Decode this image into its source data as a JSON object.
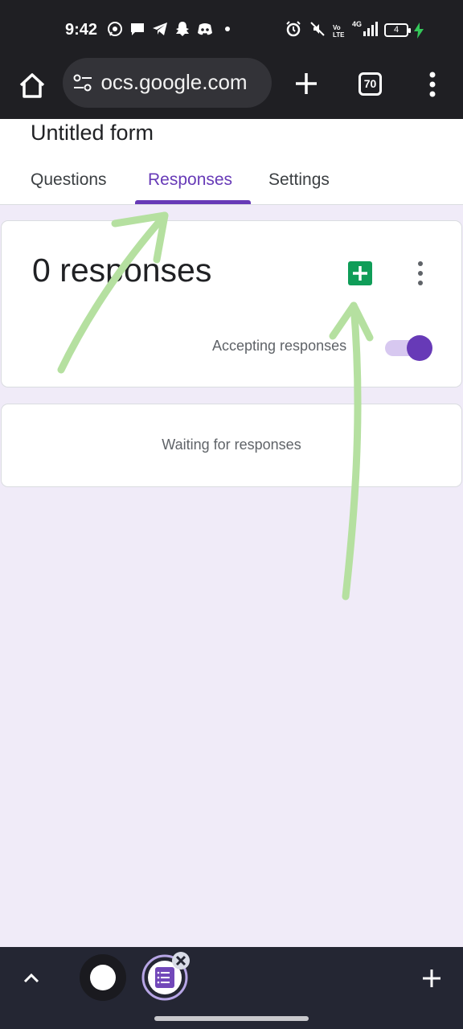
{
  "status_bar": {
    "time": "9:42",
    "battery_level": "4",
    "icons": [
      "whatsapp-icon",
      "message-icon",
      "telegram-icon",
      "snapchat-icon",
      "discord-icon",
      "dot-icon",
      "alarm-icon",
      "mute-icon",
      "volte-icon",
      "4g-signal-icon",
      "battery-icon",
      "charging-icon"
    ],
    "volte_label": "Vo LTE",
    "network_label": "4G"
  },
  "browser": {
    "url": "docs.google.com",
    "tab_count": "70",
    "icons": [
      "home-icon",
      "site-settings-icon",
      "new-tab-icon",
      "tabs-icon",
      "more-vert-icon"
    ]
  },
  "form": {
    "title": "Untitled form",
    "tabs": [
      {
        "label": "Questions"
      },
      {
        "label": "Responses"
      },
      {
        "label": "Settings"
      }
    ],
    "active_tab": "Responses",
    "accent_color": "#673ab7",
    "background_color": "#f0ebf8"
  },
  "responses": {
    "count_label": "0 responses",
    "accepting_label": "Accepting responses",
    "accepting_enabled": true,
    "waiting_label": "Waiting for responses",
    "sheets_icon": "google-sheets-icon",
    "sheets_color": "#0f9d58"
  },
  "annotations": {
    "color": "#b5e0a0",
    "arrows": [
      "arrow-to-responses-tab",
      "arrow-to-sheets-button"
    ]
  },
  "bottom_bar": {
    "icons": [
      "chevron-up-icon",
      "circle-icon",
      "forms-bubble-icon",
      "close-bubble-icon",
      "plus-icon"
    ]
  }
}
